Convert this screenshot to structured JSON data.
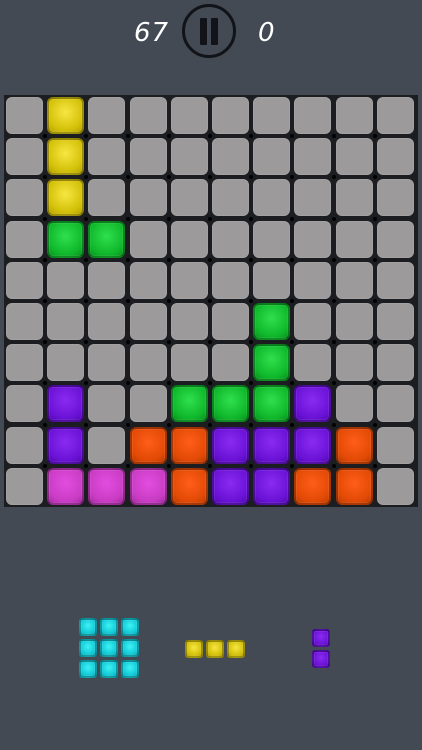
{
  "header": {
    "score": "67",
    "best": "0",
    "pause_icon": "pause-icon"
  },
  "board": {
    "rows": 10,
    "cols": 10,
    "filled": [
      {
        "r": 0,
        "c": 1,
        "color": "yellow"
      },
      {
        "r": 1,
        "c": 1,
        "color": "yellow"
      },
      {
        "r": 2,
        "c": 1,
        "color": "yellow"
      },
      {
        "r": 3,
        "c": 1,
        "color": "green"
      },
      {
        "r": 3,
        "c": 2,
        "color": "green"
      },
      {
        "r": 5,
        "c": 6,
        "color": "green"
      },
      {
        "r": 6,
        "c": 6,
        "color": "green"
      },
      {
        "r": 7,
        "c": 1,
        "color": "purple"
      },
      {
        "r": 7,
        "c": 4,
        "color": "green"
      },
      {
        "r": 7,
        "c": 5,
        "color": "green"
      },
      {
        "r": 7,
        "c": 6,
        "color": "green"
      },
      {
        "r": 7,
        "c": 7,
        "color": "purple"
      },
      {
        "r": 8,
        "c": 1,
        "color": "purple"
      },
      {
        "r": 8,
        "c": 3,
        "color": "orange"
      },
      {
        "r": 8,
        "c": 4,
        "color": "orange"
      },
      {
        "r": 8,
        "c": 5,
        "color": "purple"
      },
      {
        "r": 8,
        "c": 6,
        "color": "purple"
      },
      {
        "r": 8,
        "c": 7,
        "color": "purple"
      },
      {
        "r": 8,
        "c": 8,
        "color": "orange"
      },
      {
        "r": 9,
        "c": 1,
        "color": "pink"
      },
      {
        "r": 9,
        "c": 2,
        "color": "pink"
      },
      {
        "r": 9,
        "c": 3,
        "color": "pink"
      },
      {
        "r": 9,
        "c": 4,
        "color": "orange"
      },
      {
        "r": 9,
        "c": 5,
        "color": "purple"
      },
      {
        "r": 9,
        "c": 6,
        "color": "purple"
      },
      {
        "r": 9,
        "c": 7,
        "color": "orange"
      },
      {
        "r": 9,
        "c": 8,
        "color": "orange"
      }
    ]
  },
  "tray": {
    "pieces": [
      {
        "name": "square-3x3",
        "color": "cyan",
        "rows": 3,
        "cols": 3
      },
      {
        "name": "line-3-horizontal",
        "color": "yellow",
        "rows": 1,
        "cols": 3
      },
      {
        "name": "line-2-vertical",
        "color": "purple",
        "rows": 2,
        "cols": 1
      }
    ]
  },
  "colors": {
    "background": "#434a53",
    "empty_cell": "#9c9a9b",
    "yellow": "#d3c008",
    "green": "#0fb72a",
    "purple": "#6a12d6",
    "orange": "#e24a05",
    "pink": "#c93cc4",
    "cyan": "#11c9d6"
  }
}
